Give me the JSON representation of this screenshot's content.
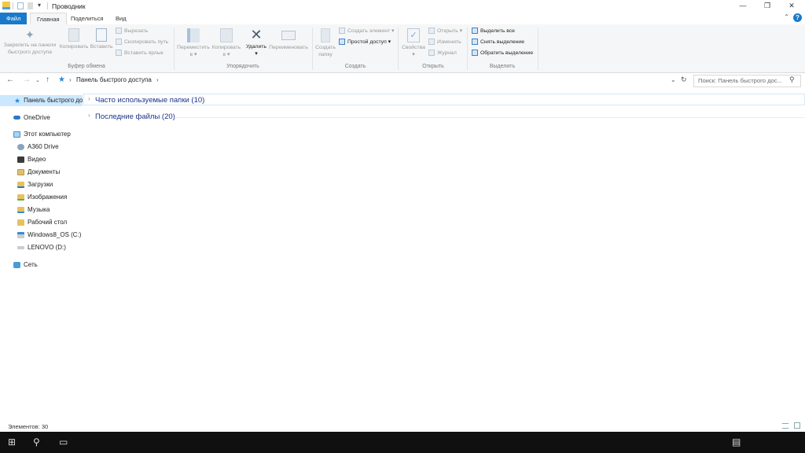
{
  "window": {
    "title": "Проводник",
    "controls": [
      "minimize-icon",
      "maximize-icon",
      "close-icon"
    ]
  },
  "tabs": [
    {
      "label": "Файл"
    },
    {
      "label": "Главная"
    },
    {
      "label": "Поделиться"
    },
    {
      "label": "Вид"
    }
  ],
  "ribbon": {
    "clipboard": {
      "label": "Буфер обмена",
      "pin": "Закрепить на панели быстрого доступа",
      "pin_l1": "Закрепить на панели",
      "pin_l2": "быстрого доступа",
      "copy": "Копировать",
      "paste": "Вставить",
      "cut": "Вырезать",
      "copy_path": "Скопировать путь",
      "paste_shortcut": "Вставить ярлык"
    },
    "organize": {
      "label": "Упорядочить",
      "move_l1": "Переместить",
      "move_l2": "в ▾",
      "copy_l1": "Копировать",
      "copy_l2": "в ▾",
      "delete": "Удалить",
      "delete_arrow": "▾",
      "rename": "Переименовать"
    },
    "new": {
      "label": "Создать",
      "folder_l1": "Создать",
      "folder_l2": "папку",
      "new_item": "Создать элемент ▾",
      "easy_access": "Простой доступ ▾"
    },
    "open": {
      "label": "Открыть",
      "properties": "Свойства",
      "properties_arrow": "▾",
      "open": "Открыть ▾",
      "edit": "Изменить",
      "history": "Журнал"
    },
    "select": {
      "label": "Выделить",
      "select_all": "Выделить все",
      "select_none": "Снять выделение",
      "invert": "Обратить выделение"
    }
  },
  "address": {
    "crumb": "Панель быстрого доступа",
    "search_placeholder": "Поиск: Панель быстрого дос..."
  },
  "nav": {
    "quick_access": "Панель быстрого доступа",
    "onedrive": "OneDrive",
    "this_pc": "Этот компьютер",
    "pc_items": [
      "A360 Drive",
      "Видео",
      "Документы",
      "Загрузки",
      "Изображения",
      "Музыка",
      "Рабочий стол",
      "Windows8_OS (C:)",
      "LENOVO (D:)"
    ],
    "network": "Сеть"
  },
  "content": {
    "groups": [
      "Часто используемые папки (10)",
      "Последние файлы (20)"
    ]
  },
  "status": {
    "items": "Элементов: 30"
  },
  "colors": {
    "accent": "#1979ca",
    "selection": "#cce8ff",
    "group_header": "#1e3287"
  }
}
